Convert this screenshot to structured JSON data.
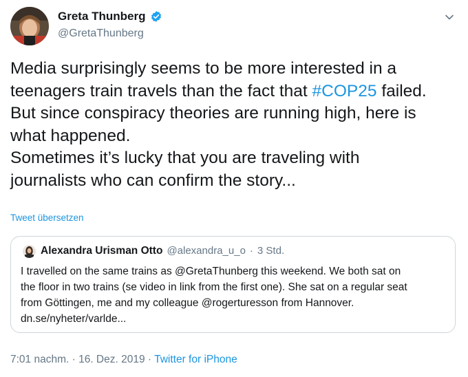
{
  "author": {
    "display_name": "Greta Thunberg",
    "handle": "@GretaThunberg",
    "verified": true,
    "avatar_icon": "profile-photo"
  },
  "tweet": {
    "lines": [
      "Media surprisingly seems to be more interested in a",
      "teenagers train travels than the fact that ",
      "But since conspiracy theories are running high, here is",
      "what happened.",
      "Sometimes it’s lucky that you are traveling with",
      "journalists who can confirm the story..."
    ],
    "hashtag": "#COP25",
    "line2_suffix": " failed."
  },
  "translate_label": "Tweet übersetzen",
  "quoted_tweet": {
    "display_name": "Alexandra Urisman Otto",
    "handle": "@alexandra_u_o",
    "separator": "·",
    "time": "3 Std.",
    "lines": [
      "I travelled on the same trains as @GretaThunberg this weekend. We both sat on",
      "the floor in two trains (se video in link from the first one). She sat on a regular seat",
      "from Göttingen, me and my colleague @rogerturesson from Hannover.",
      "dn.se/nyheter/varlde..."
    ]
  },
  "footer": {
    "timestamp": "7:01 nachm. · 16. Dez. 2019",
    "separator": " · ",
    "source": "Twitter for iPhone"
  },
  "colors": {
    "link": "#1b95e0",
    "text": "#14171a",
    "muted": "#657786",
    "border": "#ccd6dd",
    "verified": "#1da1f2"
  }
}
